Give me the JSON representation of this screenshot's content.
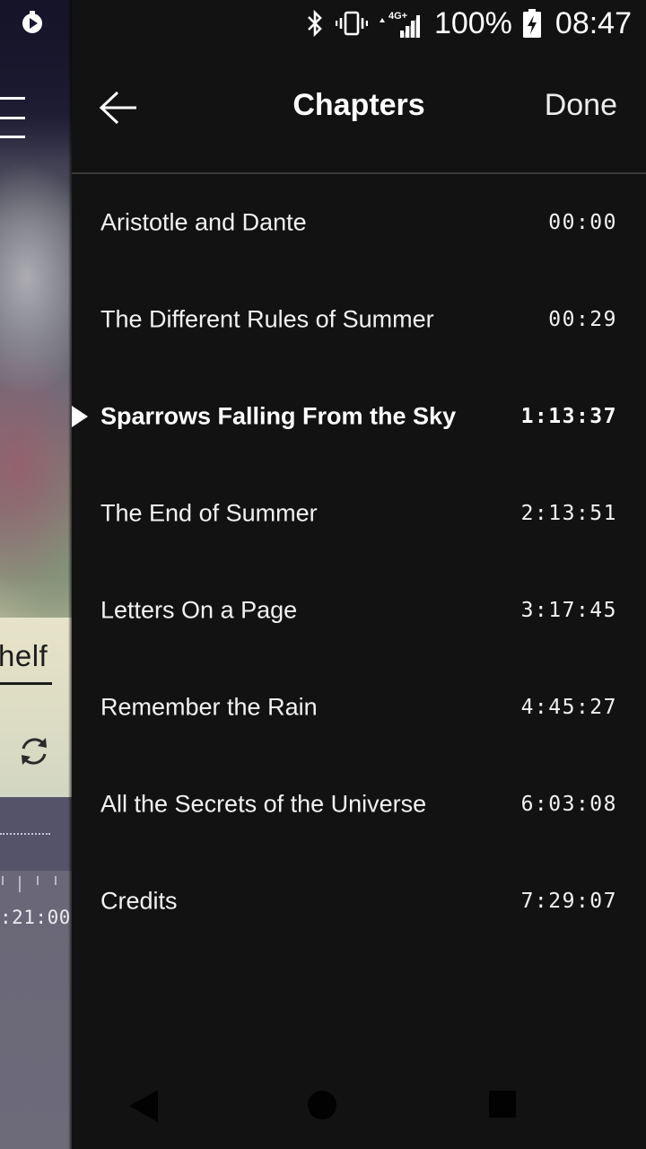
{
  "status_bar": {
    "battery_percent": "100%",
    "time": "08:47",
    "network_label": "4G+"
  },
  "background": {
    "shelf_label": "helf",
    "time_readout": ":21:00"
  },
  "header": {
    "title": "Chapters",
    "done_label": "Done"
  },
  "chapters": [
    {
      "title": "Aristotle and Dante",
      "time": "00:00",
      "current": false
    },
    {
      "title": "The Different Rules of Summer",
      "time": "00:29",
      "current": false
    },
    {
      "title": "Sparrows Falling From the Sky",
      "time": "1:13:37",
      "current": true
    },
    {
      "title": "The End of Summer",
      "time": "2:13:51",
      "current": false
    },
    {
      "title": "Letters On a Page",
      "time": "3:17:45",
      "current": false
    },
    {
      "title": "Remember the Rain",
      "time": "4:45:27",
      "current": false
    },
    {
      "title": "All the Secrets of the Universe",
      "time": "6:03:08",
      "current": false
    },
    {
      "title": "Credits",
      "time": "7:29:07",
      "current": false
    }
  ],
  "colors": {
    "panel_background": "#121212",
    "divider": "#3a3a3a",
    "text": "#f2f2f2"
  }
}
